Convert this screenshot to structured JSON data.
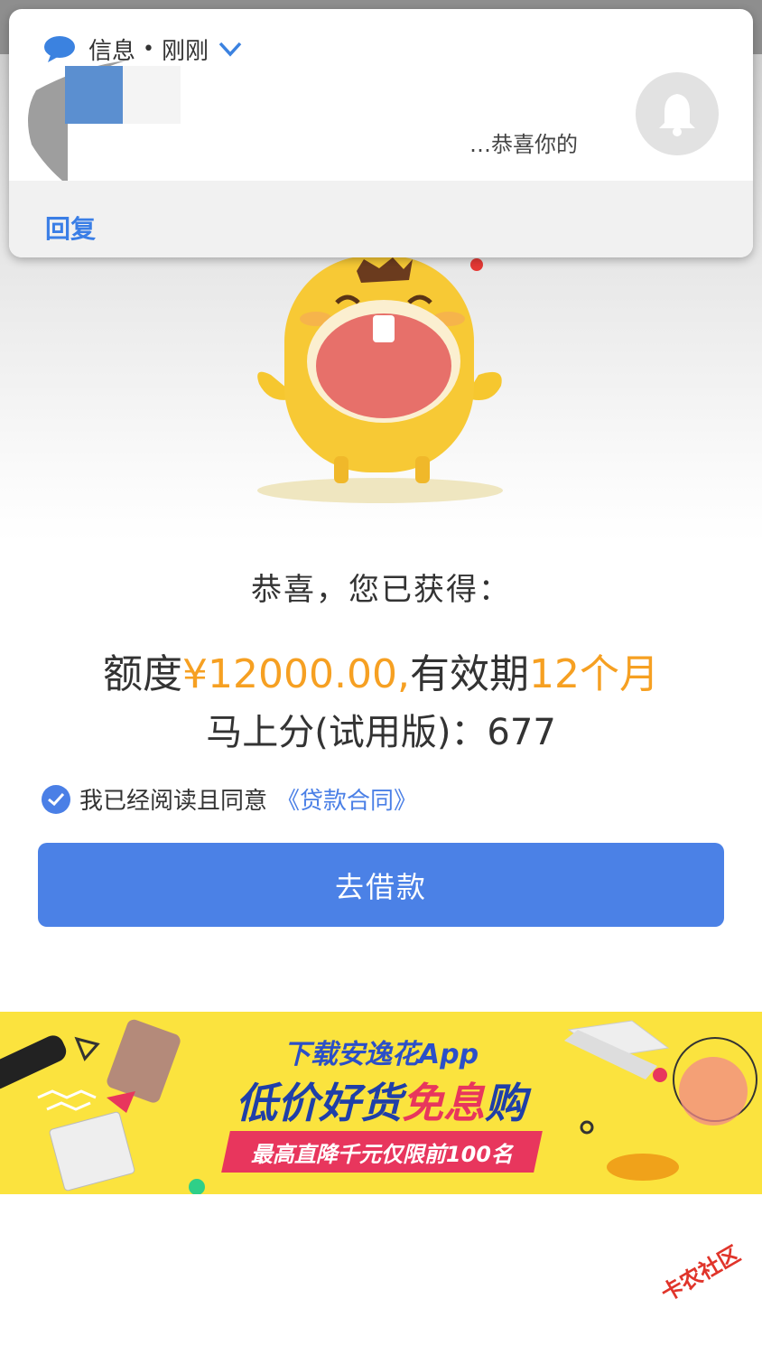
{
  "notification": {
    "app_name": "信息",
    "separator": "•",
    "time": "刚刚",
    "preview_partial": "…恭喜你的",
    "reply_label": "回复"
  },
  "offer": {
    "congrats": "恭喜，您已获得：",
    "amount_label": "额度",
    "amount_value": "¥12000.00,",
    "validity_label": "有效期",
    "validity_value": "12个月",
    "score_text": "马上分(试用版)：677"
  },
  "agreement": {
    "checked": true,
    "text": "我已经阅读且同意",
    "link": "《贷款合同》"
  },
  "primary_button": {
    "label": "去借款"
  },
  "banner": {
    "line1": "下载安逸花App",
    "line2_a": "低价好货",
    "line2_b": "免息",
    "line2_c": "购",
    "tag": "最高直降千元仅限前100名"
  },
  "watermark": "卡农社区",
  "colors": {
    "accent_blue": "#4b81e6",
    "highlight_orange": "#f6a022",
    "banner_yellow": "#fbe33e",
    "banner_red": "#e8365d"
  }
}
